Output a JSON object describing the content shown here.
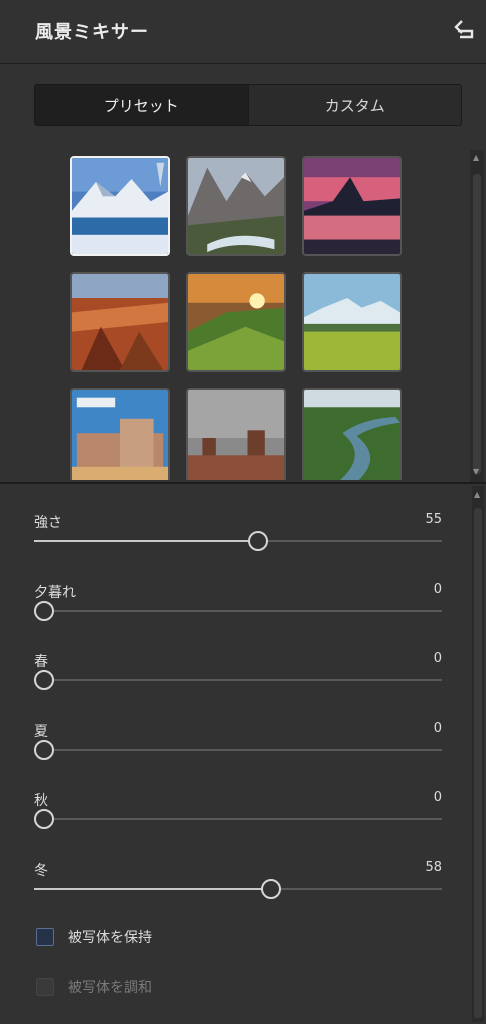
{
  "header": {
    "title": "風景ミキサー",
    "undo_icon": "undo-icon"
  },
  "tabs": [
    {
      "label": "プリセット",
      "active": true
    },
    {
      "label": "カスタム",
      "active": false
    }
  ],
  "presets": [
    {
      "name": "snowy-mountain-lake",
      "selected": true
    },
    {
      "name": "alpine-valley-river",
      "selected": false
    },
    {
      "name": "sunset-mountain-reflection",
      "selected": false
    },
    {
      "name": "grand-canyon",
      "selected": false
    },
    {
      "name": "sunrise-green-hills",
      "selected": false
    },
    {
      "name": "green-meadow-mountains",
      "selected": false
    },
    {
      "name": "desert-rock-formation",
      "selected": false
    },
    {
      "name": "monument-valley",
      "selected": false
    },
    {
      "name": "green-river-valley",
      "selected": false
    }
  ],
  "sliders": [
    {
      "label": "強さ",
      "value": "55",
      "level": 0.55
    },
    {
      "label": "夕暮れ",
      "value": "0",
      "level": 0
    },
    {
      "label": "春",
      "value": "0",
      "level": 0
    },
    {
      "label": "夏",
      "value": "0",
      "level": 0
    },
    {
      "label": "秋",
      "value": "0",
      "level": 0
    },
    {
      "label": "冬",
      "value": "58",
      "level": 0.58
    }
  ],
  "options": {
    "preserve_subject": {
      "label": "被写体を保持",
      "checked": false,
      "enabled": true
    },
    "harmonize_subject": {
      "label": "被写体を調和",
      "checked": false,
      "enabled": false
    }
  },
  "colors": {
    "background": "#323232",
    "accent": "#f2f2f2",
    "checkbox": "#263248"
  }
}
